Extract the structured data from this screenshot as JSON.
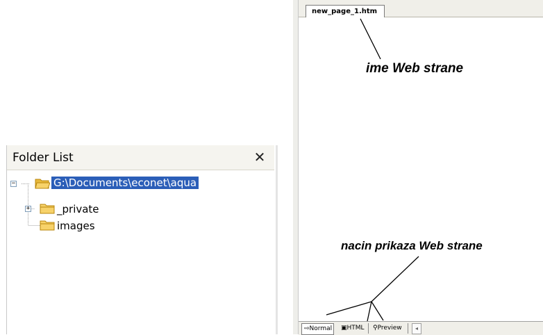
{
  "folder_list": {
    "title": "Folder List",
    "close_glyph": "✕",
    "tree": {
      "root": {
        "label": "G:\\Documents\\econet\\aqua",
        "expander": "−",
        "icon": "folder-open-icon"
      },
      "children": [
        {
          "label": "_private",
          "expander": "+",
          "icon": "folder-icon"
        },
        {
          "label": "images",
          "icon": "folder-icon"
        }
      ]
    }
  },
  "editor": {
    "document_tab": "new_page_1.htm",
    "annotations": {
      "page_name": "ime Web strane",
      "view_mode": "nacin prikaza Web strane"
    },
    "view_tabs": [
      {
        "label": "Normal",
        "icon": "normal-view-icon",
        "active": true
      },
      {
        "label": "HTML",
        "icon": "html-view-icon",
        "active": false
      },
      {
        "label": "Preview",
        "icon": "preview-view-icon",
        "active": false
      }
    ],
    "scroll_left_glyph": "◂"
  },
  "colors": {
    "selection": "#2b5eb8",
    "folder_yellow": "#f7d26a"
  }
}
